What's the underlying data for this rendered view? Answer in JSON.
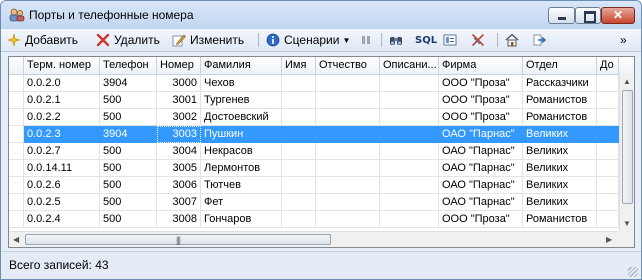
{
  "window": {
    "title": "Порты и телефонные номера"
  },
  "toolbar": {
    "add_label": "Добавить",
    "delete_label": "Удалить",
    "edit_label": "Изменить",
    "scenarios_label": "Сценарии",
    "sql_label": "SQL",
    "overflow_label": "»"
  },
  "table": {
    "columns": [
      "Терм. номер",
      "Телефон",
      "Номер",
      "Фамилия",
      "Имя",
      "Отчество",
      "Описани...",
      "Фирма",
      "Отдел",
      "До"
    ],
    "rows": [
      [
        "0.0.2.0",
        "3904",
        "3000",
        "Чехов",
        "",
        "",
        "",
        "ООО \"Проза\"",
        "Рассказчики"
      ],
      [
        "0.0.2.1",
        "500",
        "3001",
        "Тургенев",
        "",
        "",
        "",
        "ООО \"Проза\"",
        "Романистов"
      ],
      [
        "0.0.2.2",
        "500",
        "3002",
        "Достоевский",
        "",
        "",
        "",
        "ООО \"Проза\"",
        "Романистов"
      ],
      [
        "0.0.2.3",
        "3904",
        "3003",
        "Пушкин",
        "",
        "",
        "",
        "ОАО \"Парнас\"",
        "Великих"
      ],
      [
        "0.0.2.7",
        "500",
        "3004",
        "Некрасов",
        "",
        "",
        "",
        "ОАО \"Парнас\"",
        "Великих"
      ],
      [
        "0.0.14.11",
        "500",
        "3005",
        "Лермонтов",
        "",
        "",
        "",
        "ОАО \"Парнас\"",
        "Великих"
      ],
      [
        "0.0.2.6",
        "500",
        "3006",
        "Тютчев",
        "",
        "",
        "",
        "ОАО \"Парнас\"",
        "Великих"
      ],
      [
        "0.0.2.5",
        "500",
        "3007",
        "Фет",
        "",
        "",
        "",
        "ОАО \"Парнас\"",
        "Великих"
      ],
      [
        "0.0.2.4",
        "500",
        "3008",
        "Гончаров",
        "",
        "",
        "",
        "ООО \"Проза\"",
        "Романистов"
      ]
    ],
    "selected_row": 3
  },
  "status": {
    "text": "Всего записей: 43"
  },
  "colors": {
    "selection": "#3399ff",
    "frame": "#6d8db5"
  }
}
